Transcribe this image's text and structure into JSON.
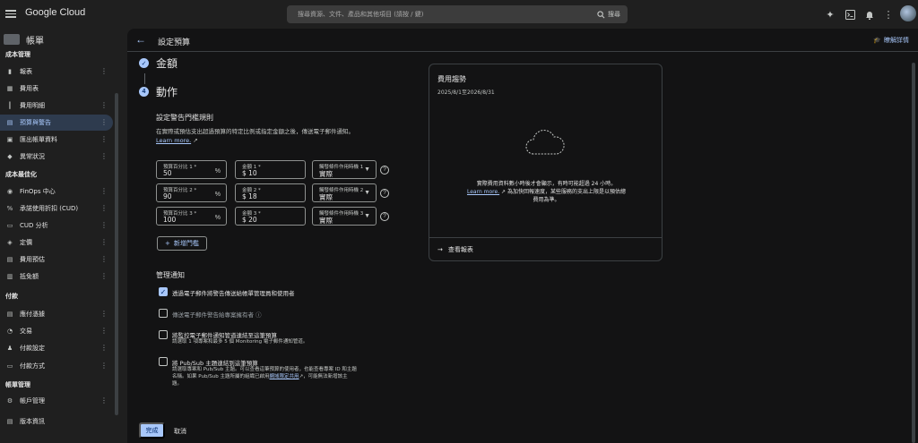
{
  "topbar": {
    "product": "Google Cloud",
    "search_placeholder": "搜尋資源、文件、產品和其他項目 (請按 / 鍵)",
    "search_button": "搜尋"
  },
  "sidebar": {
    "title": "帳單",
    "sections": {
      "cost_management": "成本管理",
      "cost_optimization": "成本最佳化",
      "payment": "付款",
      "account_management": "帳單管理"
    },
    "items": [
      {
        "label": "報表",
        "icon": "bar-chart-icon"
      },
      {
        "label": "費用表",
        "icon": "table-icon"
      },
      {
        "label": "費用明細",
        "icon": "breakdown-icon"
      },
      {
        "label": "預算與警告",
        "icon": "budget-icon",
        "active": true
      },
      {
        "label": "匯出帳單資料",
        "icon": "export-icon"
      },
      {
        "label": "異常狀況",
        "icon": "anomaly-icon"
      },
      {
        "label": "FinOps 中心",
        "icon": "finops-icon"
      },
      {
        "label": "承諾使用折扣 (CUD)",
        "icon": "cud-icon"
      },
      {
        "label": "CUD 分析",
        "icon": "cud-analysis-icon"
      },
      {
        "label": "定價",
        "icon": "pricing-icon"
      },
      {
        "label": "費用預估",
        "icon": "estimate-icon"
      },
      {
        "label": "抵免額",
        "icon": "credit-icon"
      },
      {
        "label": "應付憑據",
        "icon": "documents-icon"
      },
      {
        "label": "交易",
        "icon": "transactions-icon"
      },
      {
        "label": "付款設定",
        "icon": "payment-settings-icon"
      },
      {
        "label": "付款方式",
        "icon": "payment-method-icon"
      },
      {
        "label": "帳戶管理",
        "icon": "account-settings-icon"
      },
      {
        "label": "版本資訊",
        "icon": "release-notes-icon"
      }
    ]
  },
  "main": {
    "title": "設定預算",
    "learn_more_link": "瞭解詳情",
    "steps": [
      {
        "label": "金額",
        "state": "done"
      },
      {
        "label": "動作",
        "number": "4"
      }
    ],
    "rules": {
      "title": "設定警告門檻規則",
      "description": "在實際或預估支出超過預算的特定比例或指定金額之後，傳送電子郵件通知。",
      "learn_more": "Learn more.",
      "rows": [
        {
          "pct_label": "預算百分比 1 *",
          "pct_value": "50",
          "amount_label": "金額 1 *",
          "amount_value": "$ 10",
          "trigger_label": "觸發條件作用時機 1",
          "trigger_value": "實際"
        },
        {
          "pct_label": "預算百分比 2 *",
          "pct_value": "90",
          "amount_label": "金額 2 *",
          "amount_value": "$ 18",
          "trigger_label": "觸發條件作用時機 2",
          "trigger_value": "實際"
        },
        {
          "pct_label": "預算百分比 3 *",
          "pct_value": "100",
          "amount_label": "金額 3 *",
          "amount_value": "$ 20",
          "trigger_label": "觸發條件作用時機 3",
          "trigger_value": "實際"
        }
      ],
      "pct_suffix": "%",
      "add_threshold": "新增門檻"
    },
    "notifications": {
      "title": "管理通知",
      "options": [
        {
          "label": "透過電子郵件將警告傳送給帳單管理員和使用者",
          "checked": true
        },
        {
          "label": "傳送電子郵件警告給專案擁有者",
          "checked": false,
          "disabled": true
        },
        {
          "label": "將監控電子郵件通知管道連結至這筆預算",
          "checked": false,
          "sub": "請選取 1 項專案和最多 5 個 Monitoring 電子郵件通知管道。"
        },
        {
          "label": "將 Pub/Sub 主題連結到這筆預算",
          "checked": false,
          "sub1": "請選取專案和 Pub/Sub 主題。可以查看這筆預算的使用者，也能查看專案 ID 和主題",
          "sub2": "名稱。如果 Pub/Sub 主題所屬的組織已啟用",
          "sub_link": "網域限定共用",
          "sub3": "，可能無法新增該主",
          "sub4": "題。"
        }
      ]
    },
    "done_button": "完成",
    "cancel_button": "取消"
  },
  "trend": {
    "title": "費用趨勢",
    "range": "2025/8/1至2026/8/31",
    "message1": "實際費用資料數小時後才會顯示，有時可能超過 24 小時。",
    "message_link": "Learn more.",
    "message2": "為加快回報速度，某些服務的支出上限是以預估總",
    "message3": "費用為準。",
    "view_report": "查看報表"
  },
  "colors": {
    "accent": "#a8c7fa",
    "background": "#131314",
    "chrome": "#1f1f1f",
    "active_nav": "#2e3b4e"
  }
}
